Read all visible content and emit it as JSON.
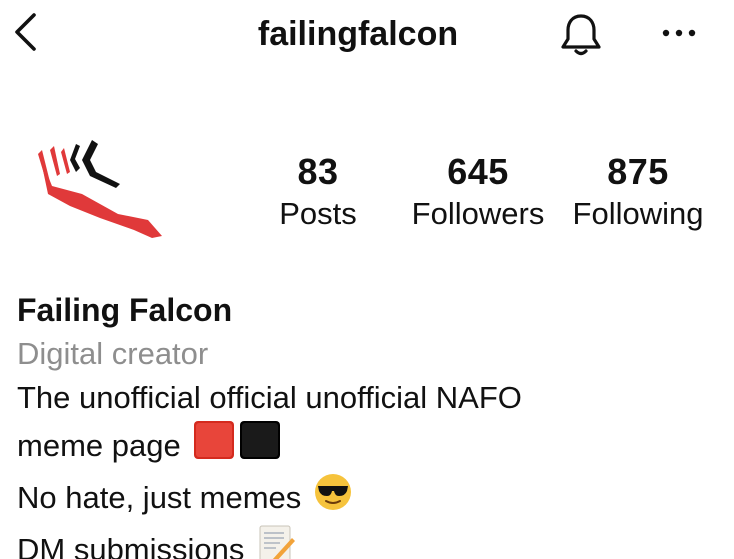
{
  "header": {
    "username": "failingfalcon",
    "back_icon": "chevron-left-icon",
    "bell_icon": "bell-icon",
    "more_icon": "more-horizontal-icon"
  },
  "stats": {
    "posts": {
      "count": "83",
      "label": "Posts"
    },
    "followers": {
      "count": "645",
      "label": "Followers"
    },
    "following": {
      "count": "875",
      "label": "Following"
    }
  },
  "bio": {
    "display_name": "Failing Falcon",
    "category": "Digital creator",
    "line1": "The unofficial official unofficial NAFO",
    "line2": "meme page",
    "line3": "No hate, just memes",
    "line4": "DM submissions"
  },
  "colors": {
    "logo_red": "#e0393a",
    "logo_black": "#111111",
    "category_gray": "#8e8e8e",
    "red_square": "#d42a1e",
    "emoji_yellow": "#f6c33c"
  }
}
